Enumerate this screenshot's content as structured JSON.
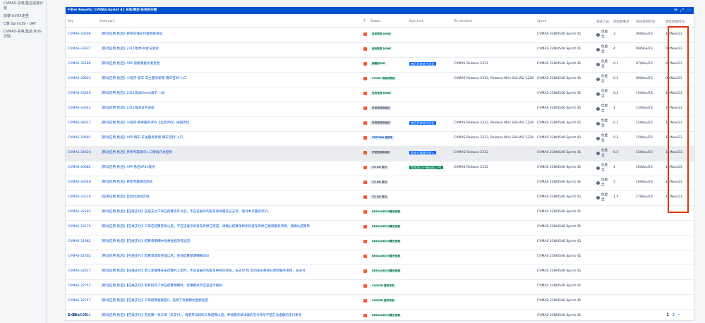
{
  "sidebar": {
    "items": [
      {
        "label": "CVMAS-充电/售后进度计划"
      },
      {
        "label": "前端-UI/UX走查"
      },
      {
        "label": "C端 Sprint39 - UAT"
      },
      {
        "label": "CVMAS-充电/售后 BUG详情"
      }
    ]
  },
  "panel": {
    "title": "Filter Results: CVMAS-Sprint 41 充电/售后-任务拆分图",
    "icons": [
      "refresh-icon",
      "expand-icon",
      "menu-icon"
    ]
  },
  "table": {
    "headers": {
      "key": "Key",
      "summary": "Summary",
      "type": "T",
      "status": "Status",
      "epic": "Epic Link",
      "fixversions": "Fix Versions",
      "sprint": "Sprint",
      "tester": "测试人员",
      "points": "测试故事点",
      "start": "测试开始时间",
      "end": "测试结束时间"
    },
    "rows": [
      {
        "key": "CVMAS-33598",
        "summary": "【移动应用-售后】养修在线支付跳到跳测试",
        "type_color": "#ff5630",
        "status": "任务完成 DONE",
        "status_style": "done",
        "epic": "",
        "epic_color": "",
        "fixversions": "",
        "sprint": "CVMAS 23W4546 Sprint 41",
        "tester": "仇金全",
        "points": "3",
        "start": "06/Nov/23",
        "end": "10/Nov/23"
      },
      {
        "key": "CVMAS-33337",
        "summary": "【移动应用-售后】2311版本FN登记测试",
        "type_color": "#ff5630",
        "status": "任务完成 DONE",
        "status_style": "done",
        "epic": "",
        "epic_color": "",
        "fixversions": "",
        "sprint": "CVMAS 23W4546 Sprint 41",
        "tester": "仇金全",
        "points": "4",
        "start": "06/Nov/23",
        "end": "09/Nov/23"
      },
      {
        "key": "CVMAS-35186",
        "summary": "【移动应用-售后】APP 道路救援文案变更",
        "type_color": "#ff5630",
        "status": "部署到PRE",
        "status_style": "done",
        "epic": "售后养修迭代优化",
        "epic_color": "#0065ff",
        "fixversions": "CVMAS Release 2311",
        "sprint": "CVMAS 23W4546 Sprint 41",
        "tester": "仇金全",
        "points": "0.1",
        "start": "07/Nov/23",
        "end": "07/Nov/23"
      },
      {
        "key": "CVMAS-30693",
        "summary": "【移动应用-售后】小程序-爱车-车主服务新增-用车百科\"入口",
        "type_color": "#ff5630",
        "status": "STORY 待测试完成",
        "status_style": "done",
        "epic": "",
        "epic_color": "",
        "fixversions": "CVMAS Release 2312, Release Mini S44 W2 1228",
        "sprint": "CVMAS 23W4546 Sprint 41",
        "tester": "仇金全",
        "points": "0.2",
        "start": "09/Nov/23",
        "end": "09/Nov/23"
      },
      {
        "key": "CVMAS-33340",
        "summary": "【移动应用-售后】2311版本Demo演示（UI）",
        "type_color": "#ff5630",
        "status": "任务完成 DONE",
        "status_style": "done",
        "epic": "",
        "epic_color": "",
        "fixversions": "",
        "sprint": "CVMAS 23W4546 Sprint 41",
        "tester": "仇金全",
        "points": "0.3",
        "start": "10/Nov/23",
        "end": "10/Nov/23"
      },
      {
        "key": "CVMAS-33342",
        "summary": "【移动应用-售后】2311版本业务验收",
        "type_color": "#ff5630",
        "status": "开发完成待测试",
        "status_style": "todo",
        "epic": "",
        "epic_color": "",
        "fixversions": "",
        "sprint": "CVMAS 23W4546 Sprint 41",
        "tester": "仇金全",
        "points": "1",
        "start": "13/Nov/23",
        "end": "13/Nov/23"
      },
      {
        "key": "CVMAS-34011",
        "summary": "【移动应用-售后】小程序-养修服务评价【立即评价】按钮优化",
        "type_color": "#ff5630",
        "status": "开发完成待测试",
        "status_style": "todo",
        "epic": "售后养修迭代优化",
        "epic_color": "#0065ff",
        "fixversions": "CVMAS Release 2312, Release Mini S44 W2 1228",
        "sprint": "CVMAS 23W4546 Sprint 41",
        "tester": "仇金全",
        "points": "0.2",
        "start": "14/Nov/22",
        "end": "14/Nov/23"
      },
      {
        "key": "CVMAS-30692",
        "summary": "【移动应用-售后】APP-用车-车主服务新增-用车百科\"入口",
        "type_color": "#ff5630",
        "status": "TESTING 测试中",
        "status_style": "progress",
        "epic": "",
        "epic_color": "",
        "fixversions": "CVMAS Release 2312, Release Mini S44 W2 1228",
        "sprint": "CVMAS 23W4546 Sprint 41",
        "tester": "仇金全",
        "points": "0.3",
        "start": "15/Nov/23",
        "end": "15/Nov/23"
      },
      {
        "key": "CVMAS-34626",
        "summary": "【移动应用-售后】养修专属顾问入口增加开关控制",
        "type_color": "#ff5630",
        "status": "开发完成待测试",
        "status_style": "todo",
        "epic": "养修专属顾问接入",
        "epic_color": "#0065ff",
        "fixversions": "CVMAS Release 2312",
        "sprint": "CVMAS 23W4546 Sprint 41",
        "tester": "仇金全",
        "points": "0.5",
        "start": "15/Nov/23",
        "end": "15/Nov/23",
        "hl": true
      },
      {
        "key": "CVMAS-30682",
        "summary": "【移动应用-售后】APP 售后SP41埋点",
        "type_color": "#ff5630",
        "status": "TO DO 待办",
        "status_style": "todo",
        "epic": "常规埋点+指标埋点-P1",
        "epic_color": "#00875a",
        "fixversions": "CVMAS Release 2312",
        "sprint": "CVMAS 23W4546 Sprint 41",
        "tester": "仇金全",
        "points": "1",
        "start": "16/Nov/23",
        "end": "16/Nov/23"
      },
      {
        "key": "CVMAS-30348",
        "summary": "【移动应用-售后】养修专属顾问测试",
        "type_color": "#ff5630",
        "status": "TO DO 待办",
        "status_style": "todo",
        "epic": "",
        "epic_color": "",
        "fixversions": "",
        "sprint": "CVMAS 23W4546 Sprint 41",
        "tester": "仇金全",
        "points": "5",
        "start": "16/Nov/23",
        "end": "15/Nov/23"
      },
      {
        "key": "CVMAS-35226",
        "summary": "【应用应用-售后】自动化测试实践",
        "type_color": "#ff5630",
        "status": "TO DO 待办",
        "status_style": "todo",
        "epic": "",
        "epic_color": "",
        "fixversions": "",
        "sprint": "CVMAS 23W4546 Sprint 41",
        "tester": "仇金全",
        "points": "1.5",
        "start": "17/Nov/23",
        "end": "17/Nov/23"
      },
      {
        "key": "CVMAS-32183",
        "summary": "【移动应用-售后】【在线支付】在线支付工单在结算完毕以后，不应该展示的爱车养修服务已支付，请对本次服务评价。",
        "type_color": "#ff5630",
        "status": "RESOLVED 问题已修复",
        "status_style": "done",
        "epic": "",
        "epic_color": "",
        "fixversions": "",
        "sprint": "CVMAS 23W4546 Sprint 41",
        "tester": "",
        "points": "",
        "start": "",
        "end": ""
      },
      {
        "key": "CVMAS-32179",
        "summary": "【移动应用-售后】【在线支付】工单在结算完毕以后，不应该展示的爱车养修已完成，请确认结算单和您的爱车养修已更新服务项目，请确认结算单",
        "type_color": "#ff5630",
        "status": "RESOLVED 问题已修复",
        "status_style": "done",
        "epic": "",
        "epic_color": "",
        "fixversions": "",
        "sprint": "CVMAS 23W4546 Sprint 41",
        "tester": "",
        "points": "",
        "start": "",
        "end": ""
      },
      {
        "key": "CVMAS-31982",
        "summary": "【移动应用-售后】【在线支付】结算单明细中优惠金额没有返回",
        "type_color": "#ff5630",
        "status": "RESOLVED 问题已修复",
        "status_style": "done",
        "epic": "",
        "epic_color": "",
        "fixversions": "",
        "sprint": "CVMAS 23W4546 Sprint 41",
        "tester": "",
        "points": "",
        "start": "",
        "end": ""
      },
      {
        "key": "CVMAS-32762",
        "summary": "【移动应用-售后】【在线支付】结算单退款完成以后，查询结算单明细报500",
        "type_color": "#ff5630",
        "status": "RESOLVED 问题已修复",
        "status_style": "done",
        "epic": "",
        "epic_color": "",
        "fixversions": "",
        "sprint": "CVMAS 23W4546 Sprint 41",
        "tester": "",
        "points": "",
        "start": "",
        "end": ""
      },
      {
        "key": "CVMAS-32617",
        "summary": "【移动应用-售后】【在线支付】地工单使用在未结算的工单时，不应该展示的爱车养修已完成，去支付 和 您的爱车养修已更新服务项目，去支付",
        "type_color": "#ff5630",
        "status": "RESOLVED 问题已修复",
        "status_style": "done",
        "epic": "",
        "epic_color": "",
        "fixversions": "",
        "sprint": "CVMAS 23W4546 Sprint 41",
        "tester": "",
        "points": "",
        "start": "",
        "end": ""
      },
      {
        "key": "CVMAS-32742",
        "summary": "【移动应用-售后】【在线支付】有折扣的工单在结算明细时，优惠模式不应该显示规则",
        "type_color": "#ff5630",
        "status": "CLOSED 暂时关闭",
        "status_style": "done",
        "epic": "",
        "epic_color": "",
        "fixversions": "",
        "sprint": "CVMAS 23W4546 Sprint 41",
        "tester": "",
        "points": "",
        "start": "",
        "end": ""
      },
      {
        "key": "CVMAS-32747",
        "summary": "【移动应用-售后】【在线支付】工单结算金额是0，选择了优惠模式金额会变",
        "type_color": "#ff5630",
        "status": "CLOSED 暂时关闭",
        "status_style": "done",
        "epic": "",
        "epic_color": "",
        "fixversions": "",
        "sprint": "CVMAS 23W4546 Sprint 41",
        "tester": "",
        "points": "",
        "start": "",
        "end": ""
      },
      {
        "key": "CVMAS-32664",
        "summary": "【移动应用-售后】【在线支付】先结算一张工单（未支付），再看开具新的工单结算以后，养修服务单详情的支付单号不是汇总金额的支付单号",
        "type_color": "#ff5630",
        "status": "RESOLVED 问题已修复",
        "status_style": "done",
        "epic": "",
        "epic_color": "",
        "fixversions": "",
        "sprint": "CVMAS 23W4546 Sprint 41",
        "tester": "",
        "points": "",
        "start": "",
        "end": ""
      }
    ]
  },
  "footer": {
    "range": "1–20",
    "of_text": "of 29",
    "pages": [
      "1",
      "2"
    ],
    "next": "›"
  },
  "colors": {
    "header_bg": "#0052cc",
    "highlight_box": "#de350b",
    "link": "#0052cc"
  }
}
